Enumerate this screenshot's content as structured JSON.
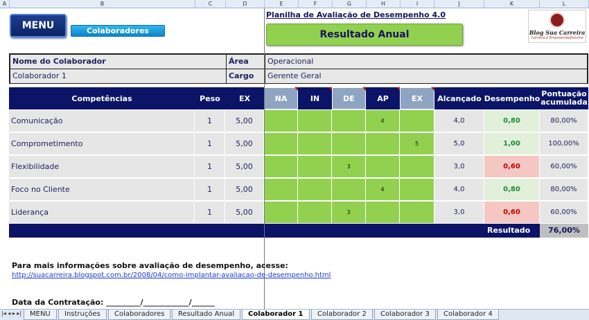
{
  "column_headers": [
    "A",
    "B",
    "C",
    "D",
    "E",
    "F",
    "G",
    "H",
    "I",
    "J",
    "K",
    "L"
  ],
  "menu_label": "MENU",
  "colaboradores_label": "Colaboradores",
  "sheet_title": "Planilha de Avaliação de Desempenho 4.0",
  "result_button": "Resultado Anual",
  "logo": {
    "line1": "Blog Sua Carreira",
    "line2": "Carreira e Empreendedorismo"
  },
  "info": {
    "name_label": "Nome do Colaborador",
    "name_value": "Colaborador 1",
    "area_label": "Área",
    "area_value": "Operacional",
    "cargo_label": "Cargo",
    "cargo_value": "Gerente Geral"
  },
  "table": {
    "headers": {
      "competencias": "Competências",
      "peso": "Peso",
      "ex": "EX",
      "na": "NA",
      "in": "IN",
      "de": "DE",
      "ap": "AP",
      "ex2": "EX",
      "alcancado": "Alcançado",
      "desempenho": "Desempenho",
      "pontuacao": "Pontuação acumulada"
    },
    "rows": [
      {
        "name": "Comunicação",
        "peso": "1",
        "ex": "5,00",
        "na": "",
        "in": "",
        "de": "",
        "ap": "4",
        "ex2": "",
        "alc": "4,0",
        "des": "0,80",
        "des_status": "good",
        "pon": "80,00%"
      },
      {
        "name": "Comprometimento",
        "peso": "1",
        "ex": "5,00",
        "na": "",
        "in": "",
        "de": "",
        "ap": "",
        "ex2": "5",
        "alc": "5,0",
        "des": "1,00",
        "des_status": "good",
        "pon": "100,00%"
      },
      {
        "name": "Flexibilidade",
        "peso": "1",
        "ex": "5,00",
        "na": "",
        "in": "",
        "de": "3",
        "ap": "",
        "ex2": "",
        "alc": "3,0",
        "des": "0,60",
        "des_status": "bad",
        "pon": "60,00%"
      },
      {
        "name": "Foco no Cliente",
        "peso": "1",
        "ex": "5,00",
        "na": "",
        "in": "",
        "de": "",
        "ap": "4",
        "ex2": "",
        "alc": "4,0",
        "des": "0,80",
        "des_status": "good",
        "pon": "80,00%"
      },
      {
        "name": "Liderança",
        "peso": "1",
        "ex": "5,00",
        "na": "",
        "in": "",
        "de": "3",
        "ap": "",
        "ex2": "",
        "alc": "3,0",
        "des": "0,60",
        "des_status": "bad",
        "pon": "60,00%"
      }
    ],
    "result_label": "Resultado",
    "result_value": "76,00%"
  },
  "note": "Para mais informações sobre avaliação de desempenho, acesse:",
  "link": "http://suacarreira.blogspot.com.br/2008/04/como-implantar-avaliacao-de-desempenho.html",
  "hire_date": "Data da Contratação: _________/____________/______",
  "colors": {
    "navy": "#0b1466",
    "green_cell": "#92d050",
    "good_bg": "#e2efda",
    "good_fg": "#1e8a3a",
    "bad_bg": "#f4c7c3",
    "bad_fg": "#c00000"
  },
  "sheet_tabs": [
    "MENU",
    "Instruções",
    "Colaboradores",
    "Resultado Anual",
    "Colaborador 1",
    "Colaborador 2",
    "Colaborador 3",
    "Colaborador 4"
  ],
  "active_tab": "Colaborador 1"
}
